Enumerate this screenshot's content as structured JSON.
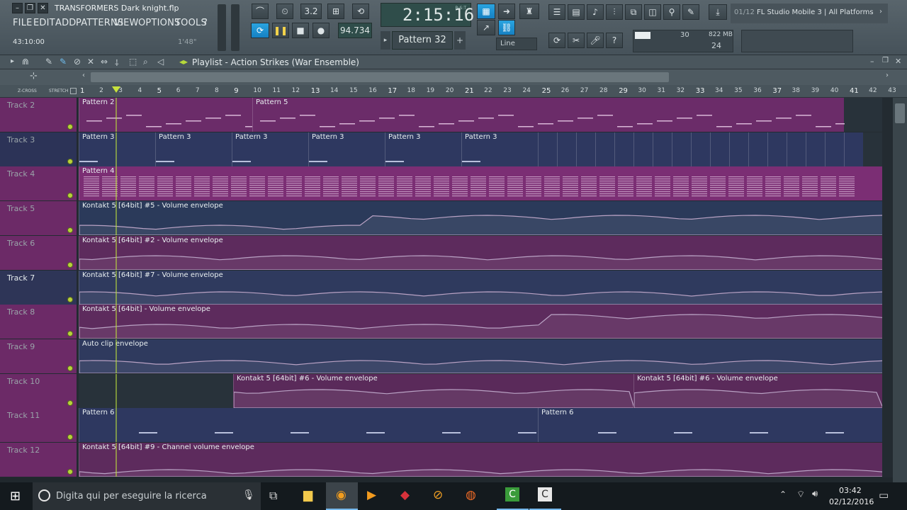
{
  "window": {
    "file_title": "TRANSFORMERS Dark knight.flp",
    "time_readout": "43:10:00",
    "time_small": "1'48\""
  },
  "menu": [
    "FILE",
    "EDIT",
    "ADD",
    "PATTERNS",
    "VIEW",
    "OPTIONS",
    "TOOLS",
    "?"
  ],
  "transport": {
    "tempo": "94.734",
    "song_time": "2:15:16",
    "time_unit": "B:S:T",
    "pattern": "Pattern 32",
    "snap": "Line",
    "beats": "3.2"
  },
  "meters": {
    "cpu": "30",
    "memory": "822 MB",
    "polyphony": "24"
  },
  "news": {
    "counter": "01/12",
    "text": "FL Studio Mobile 3 | All Platforms"
  },
  "playlist": {
    "title": "Playlist - Action Strikes (War Ensemble)",
    "ruler_labels": {
      "zcross": "Z-CROSS",
      "stretch": "STRETCH"
    },
    "ruler": [
      "1",
      "2",
      "3",
      "4",
      "5",
      "6",
      "7",
      "8",
      "9",
      "10",
      "11",
      "12",
      "13",
      "14",
      "15",
      "16",
      "17",
      "18",
      "19",
      "20",
      "21",
      "22",
      "23",
      "24",
      "25",
      "26",
      "27",
      "28",
      "29",
      "30",
      "31",
      "32",
      "33",
      "34",
      "35",
      "36",
      "37",
      "38",
      "39",
      "40",
      "41",
      "42",
      "43"
    ],
    "tracks": [
      {
        "name": "Track 2",
        "clips": [
          "Pattern 2",
          "Pattern 5"
        ]
      },
      {
        "name": "Track 3",
        "clips": [
          "Pattern 3",
          "Pattern 3",
          "Pattern 3",
          "Pattern 3",
          "Pattern 3",
          "Pattern 3"
        ]
      },
      {
        "name": "Track 4",
        "clips": [
          "Pattern 4"
        ]
      },
      {
        "name": "Track 5",
        "clips": [
          "Kontakt 5 [64bit] #5 - Volume envelope"
        ]
      },
      {
        "name": "Track 6",
        "clips": [
          "Kontakt 5 [64bit] #2 - Volume envelope"
        ]
      },
      {
        "name": "Track 7",
        "clips": [
          "Kontakt 5 [64bit] #7 - Volume envelope"
        ]
      },
      {
        "name": "Track 8",
        "clips": [
          "Kontakt 5 [64bit] - Volume envelope"
        ]
      },
      {
        "name": "Track 9",
        "clips": [
          "Auto clip envelope"
        ]
      },
      {
        "name": "Track 10",
        "clips": [
          "Kontakt 5 [64bit] #6 - Volume envelope",
          "Kontakt 5 [64bit] #6 - Volume envelope"
        ]
      },
      {
        "name": "Track 11",
        "clips": [
          "Pattern 6",
          "Pattern 6"
        ]
      },
      {
        "name": "Track 12",
        "clips": [
          "Kontakt 5 [64bit] #9 - Channel volume envelope"
        ]
      }
    ]
  },
  "taskbar": {
    "search_placeholder": "Digita qui per eseguire la ricerca",
    "time": "03:42",
    "date": "02/12/2016"
  },
  "colors": {
    "pattern": "#7a2f74",
    "automation": "#5e2c5e",
    "blue_clip": "#2f3a63",
    "accent": "#1e8fd8"
  }
}
